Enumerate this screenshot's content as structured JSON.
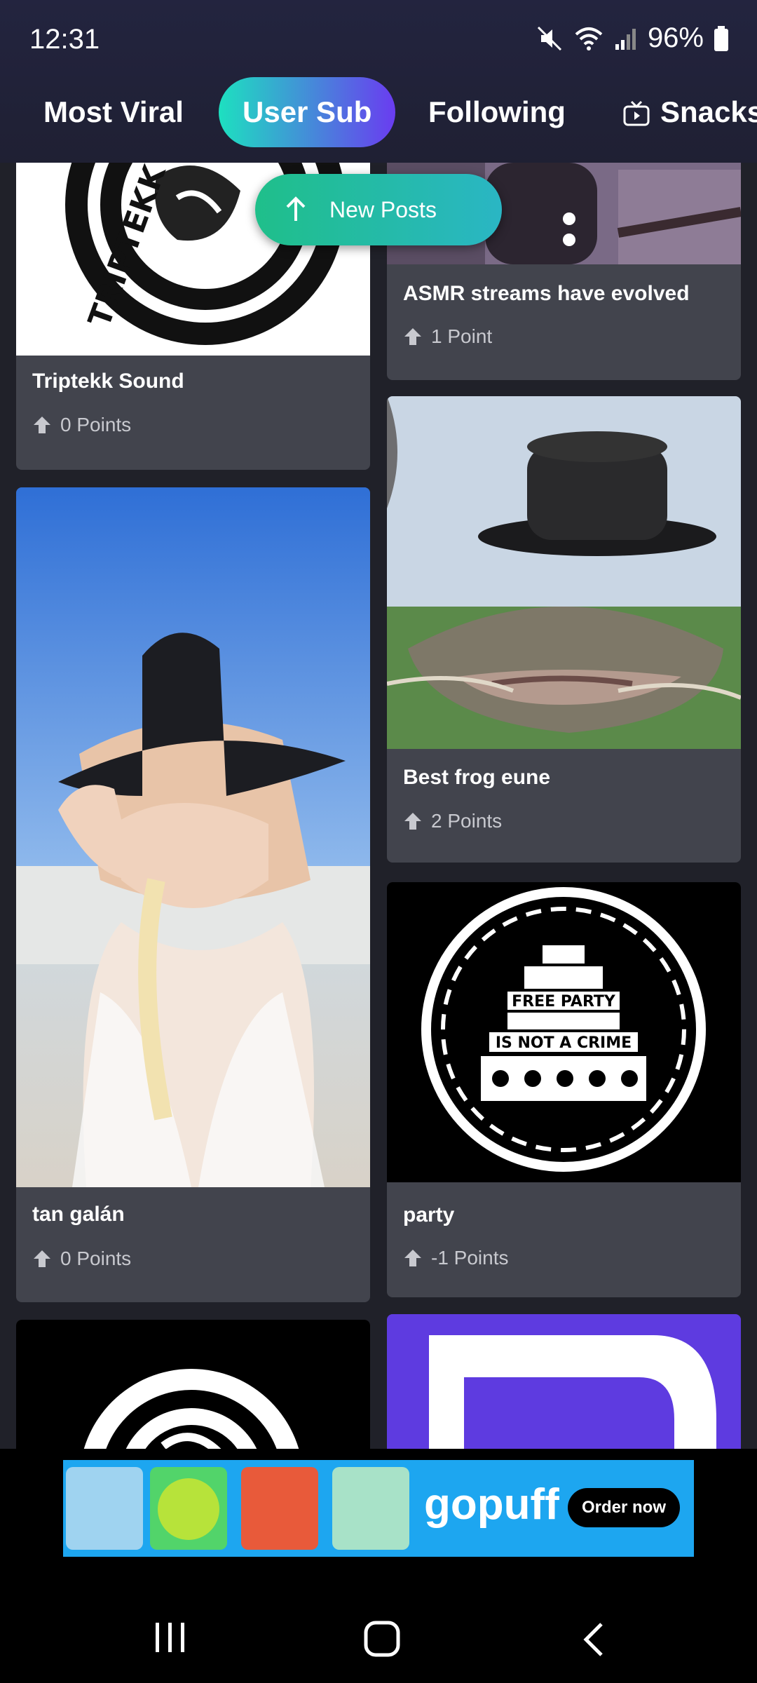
{
  "status": {
    "time": "12:31",
    "battery": "96%"
  },
  "tabs": [
    {
      "label": "Most Viral",
      "active": false
    },
    {
      "label": "User Sub",
      "active": true
    },
    {
      "label": "Following",
      "active": false
    },
    {
      "label": "Snacks",
      "active": false
    }
  ],
  "new_posts": {
    "label": "New Posts"
  },
  "posts": [
    {
      "title": "Triptekk Sound",
      "points": "0 Points"
    },
    {
      "title": "ASMR streams have evolved",
      "points": "1 Point"
    },
    {
      "title": "tan galán",
      "points": "0 Points"
    },
    {
      "title": "Best frog eune",
      "points": "2 Points"
    },
    {
      "title": "party",
      "points": "-1 Points"
    }
  ],
  "logo_text": {
    "top": "TRIPTEKK",
    "party_lines": [
      "FREE PARTY",
      "IS NOT A CRIME"
    ]
  },
  "ad": {
    "brand": "gopuff",
    "cta": "Order now"
  },
  "colors": {
    "accent_start": "#1de0c0",
    "accent_end": "#6a3cf0",
    "card": "#42444d",
    "new_posts": "#1fbf8a"
  }
}
